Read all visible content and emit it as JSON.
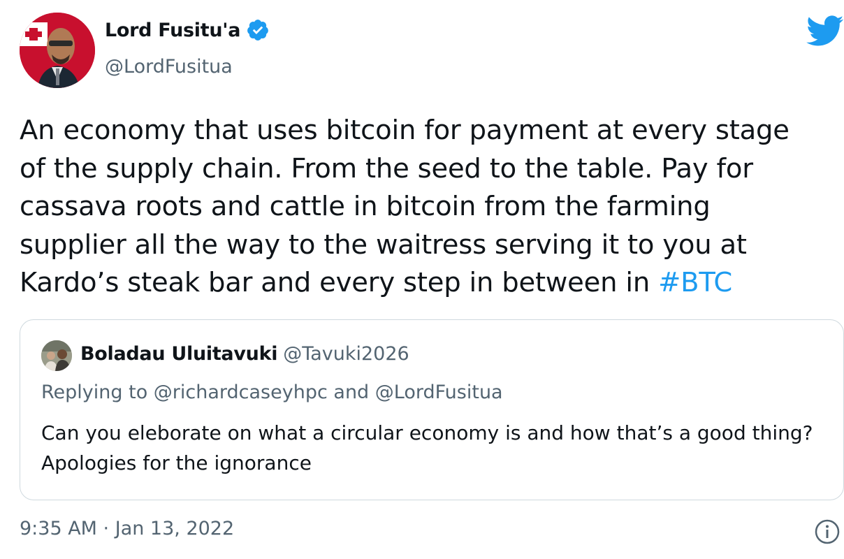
{
  "author": {
    "display_name": "Lord Fusitu'a",
    "handle": "@LordFusitua",
    "verified_icon": "verified-badge-icon",
    "avatar_icon": "author-avatar"
  },
  "tweet": {
    "text": "An economy that uses bitcoin for payment at every stage\nof the supply chain. From the seed to the table. Pay for\ncassava roots and cattle in bitcoin from the farming\nsupplier all the way to the waitress serving it to you at\nKardo’s steak bar and every step in between in ",
    "hashtag": "#BTC",
    "timestamp": "9:35 AM · Jan 13, 2022"
  },
  "quoted_tweet": {
    "display_name": "Boladau Uluitavuki",
    "handle": "@Tavuki2026",
    "replying_to": "Replying to @richardcaseyhpc and @LordFusitua",
    "text": "Can you eleborate on what a circular economy is and how that’s a good thing? Apologies for the ignorance"
  },
  "icons": {
    "brand": "twitter-bird-icon",
    "info": "info-icon"
  },
  "colors": {
    "accent": "#1d9bf0",
    "secondary_text": "#536471",
    "border": "#cfd9de"
  }
}
